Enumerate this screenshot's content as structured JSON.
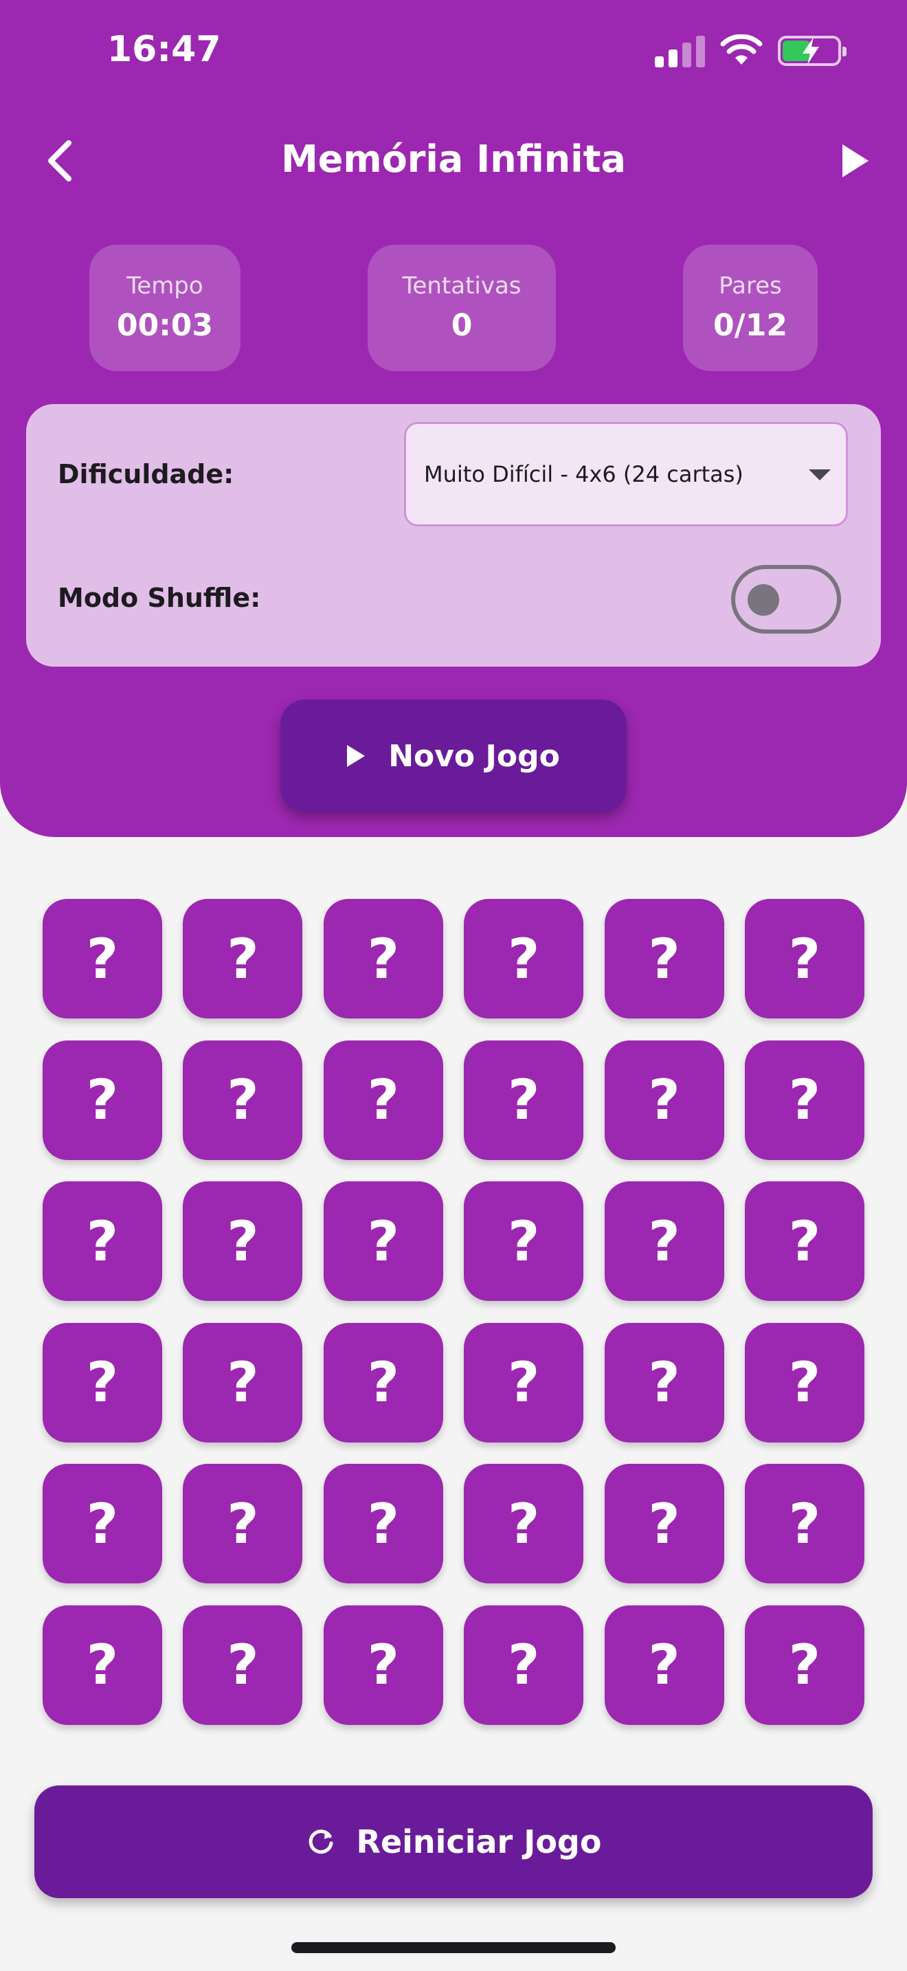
{
  "status": {
    "time": "16:47"
  },
  "nav": {
    "title": "Memória Infinita"
  },
  "stats": {
    "time_label": "Tempo",
    "time_value": "00:03",
    "tries_label": "Tentativas",
    "tries_value": "0",
    "pairs_label": "Pares",
    "pairs_value": "0/12"
  },
  "settings": {
    "difficulty_label": "Dificuldade:",
    "difficulty_value": "Muito Difícil - 4x6 (24 cartas)",
    "shuffle_label": "Modo Shuffle:",
    "shuffle_on": false
  },
  "buttons": {
    "new_game": "Novo Jogo",
    "restart": "Reiniciar Jogo"
  },
  "board": {
    "rows": 6,
    "cols": 6,
    "hidden_symbol": "?"
  },
  "colors": {
    "primary": "#9c27b0",
    "primary_dark": "#6a1b9a",
    "panel": "#e1bee7",
    "battery": "#34c759"
  }
}
